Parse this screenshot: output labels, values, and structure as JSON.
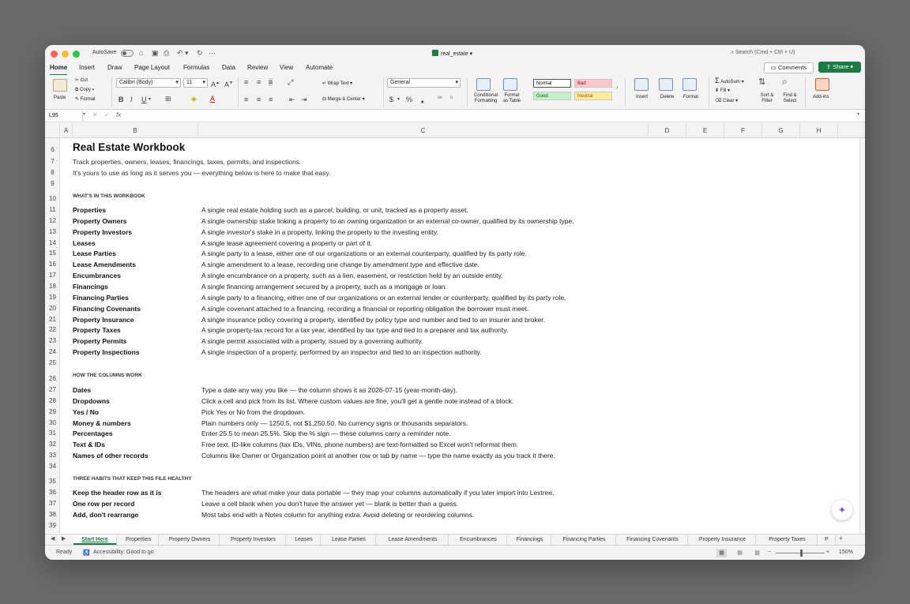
{
  "titlebar": {
    "autosave_label": "AutoSave",
    "file_name": "real_estate",
    "search_placeholder": "Search (Cmd + Ctrl + U)"
  },
  "menu": [
    "Home",
    "Insert",
    "Draw",
    "Page Layout",
    "Formulas",
    "Data",
    "Review",
    "View",
    "Automate"
  ],
  "menu_active": "Home",
  "header_buttons": {
    "comments": "Comments",
    "share": "Share"
  },
  "ribbon": {
    "paste": "Paste",
    "cut": "Cut",
    "copy": "Copy",
    "format_painter": "Format",
    "font_name": "Calibri (Body)",
    "font_size": "11",
    "wrap_text": "Wrap Text",
    "merge_center": "Merge & Center",
    "number_format": "General",
    "conditional_formatting": "Conditional Formatting",
    "format_as_table": "Format as Table",
    "styles": {
      "normal": "Normal",
      "bad": "Bad",
      "good": "Good",
      "neutral": "Neutral"
    },
    "insert": "Insert",
    "delete": "Delete",
    "format": "Format",
    "autosum": "AutoSum",
    "fill": "Fill",
    "clear": "Clear",
    "sort_filter": "Sort & Filter",
    "find_select": "Find & Select",
    "add_ins": "Add-ins"
  },
  "formula_bar": {
    "name_box": "L95",
    "fx": "fx",
    "formula": ""
  },
  "columns": [
    "A",
    "B",
    "C",
    "D",
    "E",
    "F",
    "G",
    "H"
  ],
  "sheet": {
    "title": "Real Estate Workbook",
    "subtitle_1": "Track properties, owners, leases, financings, taxes, permits, and inspections.",
    "subtitle_2": "It's yours to use as long as it serves you — everything below is here to make that easy.",
    "section_1": "WHAT'S IN THIS WORKBOOK",
    "items": [
      {
        "row": "11",
        "name": "Properties",
        "desc": "A single real estate holding such as a parcel, building, or unit, tracked as a property asset."
      },
      {
        "row": "12",
        "name": "Property Owners",
        "desc": "A single ownership stake linking a property to an owning organization or an external co-owner, qualified by its ownership type."
      },
      {
        "row": "13",
        "name": "Property Investors",
        "desc": "A single investor's stake in a property, linking the property to the investing entity."
      },
      {
        "row": "14",
        "name": "Leases",
        "desc": "A single lease agreement covering a property or part of it."
      },
      {
        "row": "15",
        "name": "Lease Parties",
        "desc": "A single party to a lease, either one of our organizations or an external counterparty, qualified by its party role."
      },
      {
        "row": "16",
        "name": "Lease Amendments",
        "desc": "A single amendment to a lease, recording one change by amendment type and effective date."
      },
      {
        "row": "17",
        "name": "Encumbrances",
        "desc": "A single encumbrance on a property, such as a lien, easement, or restriction held by an outside entity."
      },
      {
        "row": "18",
        "name": "Financings",
        "desc": "A single financing arrangement secured by a property, such as a mortgage or loan."
      },
      {
        "row": "19",
        "name": "Financing Parties",
        "desc": "A single party to a financing, either one of our organizations or an external lender or counterparty, qualified by its party role."
      },
      {
        "row": "20",
        "name": "Financing Covenants",
        "desc": "A single covenant attached to a financing, recording a financial or reporting obligation the borrower must meet."
      },
      {
        "row": "21",
        "name": "Property Insurance",
        "desc": "A single insurance policy covering a property, identified by policy type and number and tied to an insurer and broker."
      },
      {
        "row": "22",
        "name": "Property Taxes",
        "desc": "A single property-tax record for a tax year, identified by tax type and tied to a preparer and tax authority."
      },
      {
        "row": "23",
        "name": "Property Permits",
        "desc": "A single permit associated with a property, issued by a governing authority."
      },
      {
        "row": "24",
        "name": "Property Inspections",
        "desc": "A single inspection of a property, performed by an inspector and tied to an inspection authority."
      }
    ],
    "section_2": "HOW THE COLUMNS WORK",
    "columns_help": [
      {
        "row": "27",
        "name": "Dates",
        "desc": "Type a date any way you like — the column shows it as 2026-07-15 (year-month-day)."
      },
      {
        "row": "28",
        "name": "Dropdowns",
        "desc": "Click a cell and pick from its list. Where custom values are fine, you'll get a gentle note instead of a block."
      },
      {
        "row": "29",
        "name": "Yes / No",
        "desc": "Pick Yes or No from the dropdown."
      },
      {
        "row": "30",
        "name": "Money & numbers",
        "desc": "Plain numbers only — 1250.5, not $1,250.50. No currency signs or thousands separators."
      },
      {
        "row": "31",
        "name": "Percentages",
        "desc": "Enter 25.5 to mean 25.5%. Skip the % sign — these columns carry a reminder note."
      },
      {
        "row": "32",
        "name": "Text & IDs",
        "desc": "Free text. ID-like columns (tax IDs, VINs, phone numbers) are text-formatted so Excel won't reformat them."
      },
      {
        "row": "33",
        "name": "Names of other records",
        "desc": "Columns like Owner or Organization point at another row or tab by name — type the name exactly as you track it there."
      }
    ],
    "section_3": "THREE HABITS THAT KEEP THIS FILE HEALTHY",
    "habits": [
      {
        "row": "36",
        "name": "Keep the header row as it is",
        "desc": "The headers are what make your data portable — they map your columns automatically if you later import into Lextree."
      },
      {
        "row": "37",
        "name": "One row per record",
        "desc": "Leave a cell blank when you don't have the answer yet — blank is better than a guess."
      },
      {
        "row": "38",
        "name": "Add, don't rearrange",
        "desc": "Most tabs end with a Notes column for anything extra. Avoid deleting or reordering columns."
      }
    ],
    "row_numbers": {
      "r6": "6",
      "r7": "7",
      "r8": "8",
      "r9": "9",
      "r10": "10",
      "r25": "25",
      "r26": "26",
      "r34": "34",
      "r35": "35",
      "r39": "39"
    }
  },
  "sheet_tabs": [
    "Start Here",
    "Properties",
    "Property Owners",
    "Property Investors",
    "Leases",
    "Lease Parties",
    "Lease Amendments",
    "Encumbrances",
    "Financings",
    "Financing Parties",
    "Financing Covenants",
    "Property Insurance",
    "Property Taxes",
    "P"
  ],
  "active_sheet_tab": "Start Here",
  "status": {
    "ready": "Ready",
    "accessibility": "Accessibility: Good to go",
    "zoom": "150%"
  }
}
